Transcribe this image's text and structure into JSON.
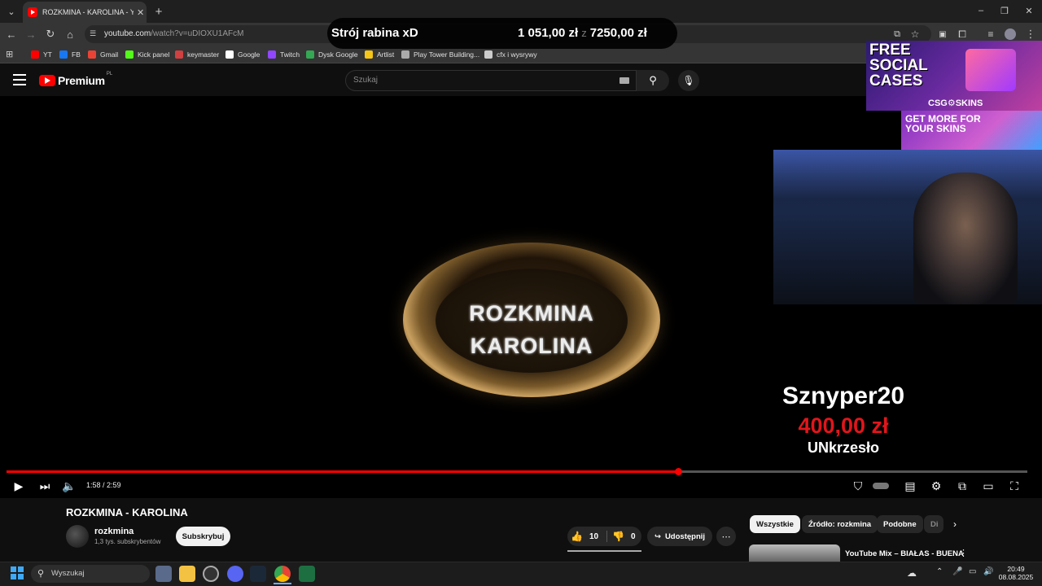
{
  "browser": {
    "tab_title": "ROZKMINA - KAROLINA - YouTube",
    "tab_close": "✕",
    "new_tab": "+",
    "url_host": "youtube.com",
    "url_path": "/watch?v=uDIOXU1AFcM",
    "window_controls": [
      "–",
      "❐",
      "✕"
    ],
    "bookmarks": [
      {
        "label": "YT",
        "color": "#ff0000"
      },
      {
        "label": "FB",
        "color": "#1877f2"
      },
      {
        "label": "Gmail",
        "color": "#ea4335"
      },
      {
        "label": "Kick panel",
        "color": "#53fc18"
      },
      {
        "label": "keymaster",
        "color": "#d04040"
      },
      {
        "label": "Google",
        "color": "#ffffff"
      },
      {
        "label": "Twitch",
        "color": "#9146ff"
      },
      {
        "label": "Dysk Google",
        "color": "#34a853"
      },
      {
        "label": "Artlist",
        "color": "#f5c518"
      },
      {
        "label": "Play Tower Building...",
        "color": "#aaaaaa"
      },
      {
        "label": "cfx i wysrywy",
        "color": "#cccccc"
      }
    ]
  },
  "youtube": {
    "logo_text": "Premium",
    "region": "PL",
    "search_placeholder": "Szukaj"
  },
  "video": {
    "disc_line1": "ROZKMINA",
    "disc_line2": "KAROLINA",
    "progress": 0.658,
    "timecode": "1:58 / 2:59",
    "title": "ROZKMINA - KAROLINA"
  },
  "overlay": {
    "goal_name": "Strój rabina xD",
    "goal_current": "1 051,00 zł",
    "goal_sep": "z",
    "goal_target": "7250,00 zł",
    "ad1_headline": "FREE SOCIAL CASES",
    "ad1_brand": "CSG⚙SKINS",
    "ad2_headline": "GET MORE FOR YOUR SKINS",
    "alert_name": "Sznyper20",
    "alert_amount": "400,00 zł",
    "alert_message": "UNkrzesło"
  },
  "channel": {
    "name": "rozkmina",
    "subscribers": "1,3 tys. subskrybentów",
    "subscribe_label": "Subskrybuj"
  },
  "actions": {
    "likes": "10",
    "dislikes": "0",
    "share_label": "Udostępnij"
  },
  "chips": [
    "Wszystkie",
    "Źródło: rozkmina",
    "Podobne",
    "Di"
  ],
  "recommendation": {
    "title": "YouTube Mix – BIAŁAS - BUENA"
  },
  "taskbar": {
    "search_placeholder": "Wyszukaj",
    "time": "20:49",
    "date": "08.08.2025"
  }
}
